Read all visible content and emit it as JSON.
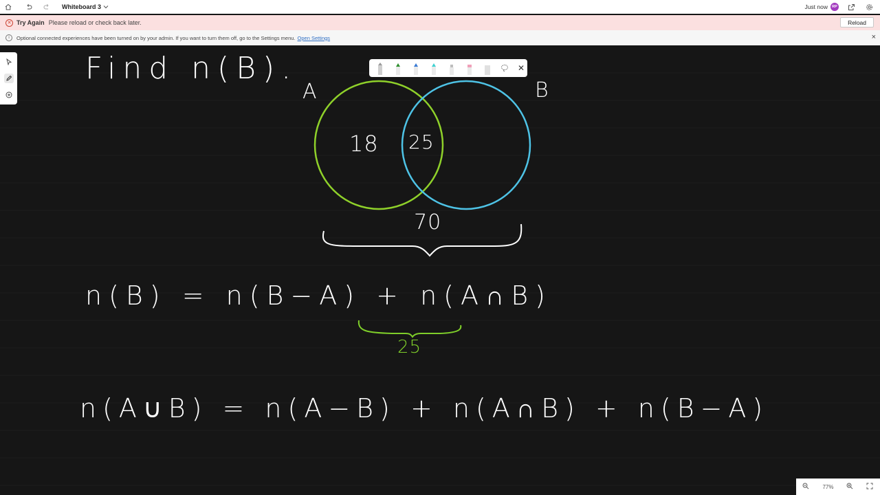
{
  "titlebar": {
    "title": "Whiteboard 3",
    "saved_status": "Just now",
    "avatar_initials": "RP"
  },
  "error_bar": {
    "title": "Try Again",
    "message": "Please reload or check back later.",
    "reload_label": "Reload"
  },
  "info_bar": {
    "message": "Optional connected experiences have been turned on by your admin. If you want to turn them off, go to the Settings menu.",
    "link_label": "Open Settings"
  },
  "whiteboard": {
    "title": "Find n(B).",
    "set_a_label": "A",
    "set_b_label": "B",
    "a_only_value": "18",
    "intersection_value": "25",
    "total_value": "70",
    "equation_1": "n(B) = n(B−A) + n(A∩B)",
    "equation_1_dot": "·",
    "intersection_annotation": "25",
    "equation_2": "n(A∪B) = n(A−B) + n(A∩B) + n(B−A)",
    "colors": {
      "set_a": "#8fd12a",
      "set_b": "#4ec3e6",
      "ink": "#ffffff",
      "annotation": "#7fcf2a"
    }
  },
  "pen_palette": {
    "pen_colors": [
      "#cfcfcf",
      "#2f8f2f",
      "#3a7bd5",
      "#3fd1d1",
      "#bdbdbd",
      "#f0a0b8",
      "#e0e0e0"
    ]
  },
  "zoom": {
    "level": "77%"
  }
}
